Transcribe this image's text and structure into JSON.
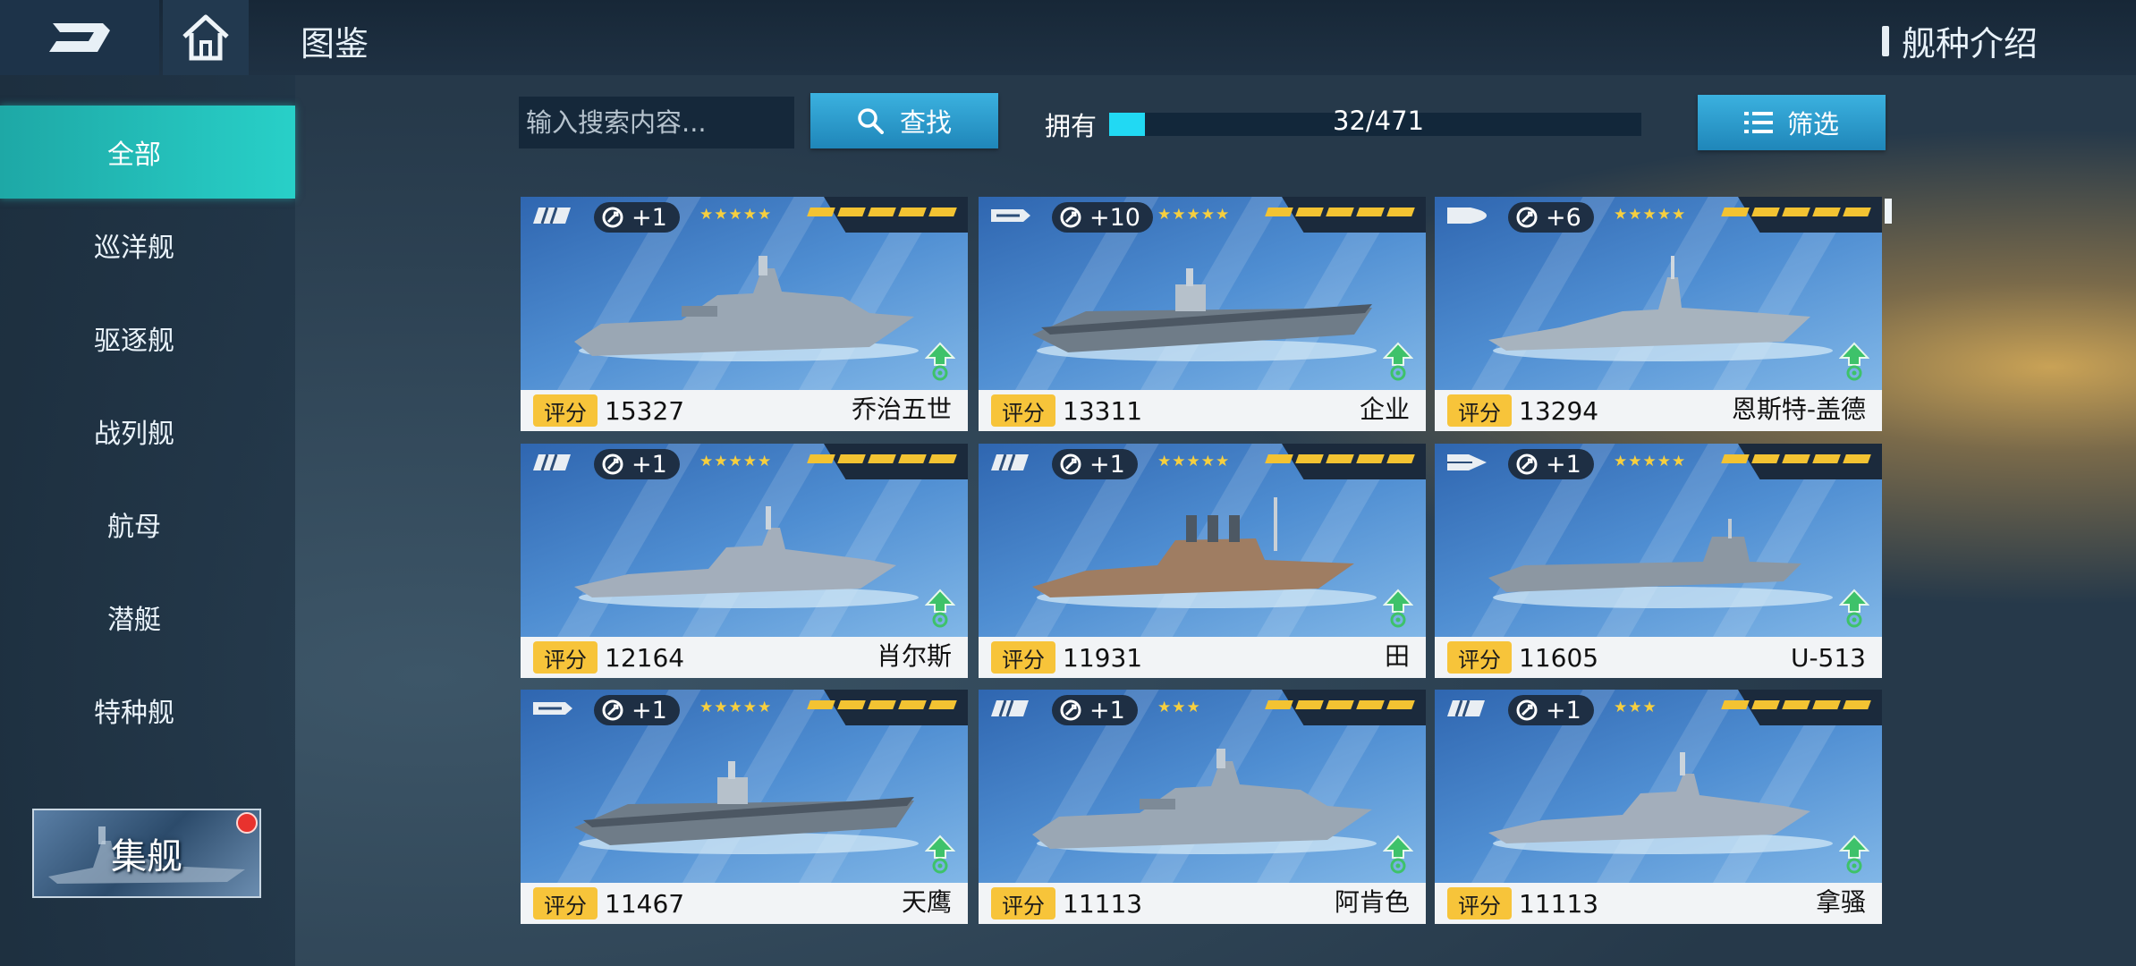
{
  "header": {
    "title": "图鉴",
    "ship_type_intro": "舰种介绍"
  },
  "sidebar": {
    "items": [
      {
        "label": "全部",
        "active": true
      },
      {
        "label": "巡洋舰"
      },
      {
        "label": "驱逐舰"
      },
      {
        "label": "战列舰"
      },
      {
        "label": "航母"
      },
      {
        "label": "潜艇"
      },
      {
        "label": "特种舰"
      }
    ],
    "fleet_button": "集舰"
  },
  "search": {
    "placeholder": "输入搜索内容...",
    "button_label": "查找"
  },
  "ownership": {
    "label": "拥有",
    "text": "32/471",
    "owned": 32,
    "total": 471
  },
  "filter": {
    "button_label": "筛选"
  },
  "score_label": "评分",
  "colors": {
    "accent_teal": "#28d0c8",
    "button_blue": "#2a9ccf",
    "score_badge": "#f7c43a",
    "progress": "#21d9f3"
  },
  "cards": [
    {
      "type_icon": "cruiser-icon",
      "level": "+1",
      "stars": 5,
      "score": "15327",
      "name": "乔治五世",
      "ship": "battleship"
    },
    {
      "type_icon": "carrier-icon",
      "level": "+10",
      "stars": 5,
      "score": "13311",
      "name": "企业",
      "ship": "carrier"
    },
    {
      "type_icon": "destroyer-icon",
      "level": "+6",
      "stars": 5,
      "score": "13294",
      "name": "恩斯特-盖德",
      "ship": "destroyer"
    },
    {
      "type_icon": "cruiser-icon",
      "level": "+1",
      "stars": 5,
      "score": "12164",
      "name": "肖尔斯",
      "ship": "cruiser"
    },
    {
      "type_icon": "cruiser-icon",
      "level": "+1",
      "stars": 5,
      "score": "11931",
      "name": "田",
      "ship": "cruiser2"
    },
    {
      "type_icon": "submarine-icon",
      "level": "+1",
      "stars": 5,
      "score": "11605",
      "name": "U-513",
      "ship": "submarine"
    },
    {
      "type_icon": "carrier-icon",
      "level": "+1",
      "stars": 5,
      "score": "11467",
      "name": "天鹰",
      "ship": "carrier"
    },
    {
      "type_icon": "battleship-icon",
      "level": "+1",
      "stars": 3,
      "score": "11113",
      "name": "阿肯色",
      "ship": "battleship"
    },
    {
      "type_icon": "battleship-icon",
      "level": "+1",
      "stars": 3,
      "score": "11113",
      "name": "拿骚",
      "ship": "cruiser"
    }
  ]
}
